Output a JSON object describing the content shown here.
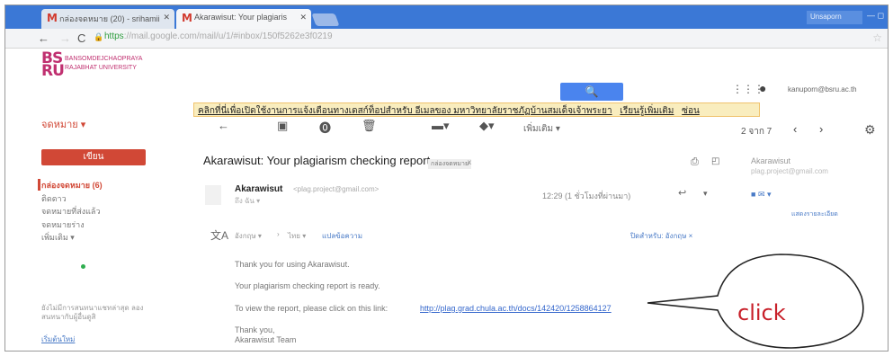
{
  "browser": {
    "tabs": [
      {
        "label": "กล่องจดหมาย (20) - srihamii"
      },
      {
        "label": "Akarawisut: Your plagiaris"
      }
    ],
    "window_label": "Unsaporn",
    "url_scheme": "https",
    "url_rest": "://mail.google.com/mail/u/1/#inbox/150f5262e3f0219"
  },
  "gmail": {
    "logo_mark": "BS\nRU",
    "logo_text": "BANSOMDEJCHAOPRAYA\nRAJABHAT UNIVERSITY",
    "compose_menu": "จดหมาย ▾",
    "compose_button": "เขียน",
    "user_email": "kanuporn@bsru.ac.th",
    "notice_text": "คลิกที่นี่เพื่อเปิดใช้งานการแจ้งเตือนทางเดสก์ท็อปสำหรับ อีเมลของ มหาวิทยาลัยราชภัฏบ้านสมเด็จเจ้าพระยา",
    "notice_learn": "เรียนรู้เพิ่มเติม",
    "notice_hide": "ซ่อน",
    "toolbar_more": "เพิ่มเติม ▾",
    "pager": "2 จาก 7"
  },
  "nav": {
    "items": [
      {
        "label": "กล่องจดหมาย (6)"
      },
      {
        "label": "ติดดาว"
      },
      {
        "label": "จดหมายที่ส่งแล้ว"
      },
      {
        "label": "จดหมายร่าง"
      },
      {
        "label": "เพิ่มเติม ▾"
      }
    ],
    "side_note": "ยังไม่มีการสนทนาแชทล่าสุด ลองสนทนากับผู้อื่นดูสิ",
    "side_link": "เริ่มต้นใหม่"
  },
  "email": {
    "subject": "Akarawisut: Your plagiarism checking report",
    "label": "กล่องจดหมาย",
    "label_close": "x",
    "sender_name": "Akarawisut",
    "sender_email": "<plag.project@gmail.com>",
    "to": "ถึง ฉัน ▾",
    "time": "12:29 (1 ชั่วโมงที่ผ่านมา)",
    "translate_from": "อังกฤษ ▾",
    "translate_arrow": "›",
    "translate_to": "ไทย ▾",
    "translate_link": "แปลข้อความ",
    "translate_off": "ปิดสำหรับ: อังกฤษ ×",
    "body": {
      "line1": "Thank you for using Akarawisut.",
      "line2": "Your plagiarism checking report is ready.",
      "line3": "To view the report, please click on this link:",
      "link": "http://plag.grad.chula.ac.th/docs/142420/1258864127",
      "line4": "Thank you,",
      "line5": "Akarawisut Team"
    }
  },
  "contact": {
    "name": "Akarawisut",
    "email": "plag.project@gmail.com",
    "more": "แสดงรายละเอียด"
  },
  "annotation": {
    "label": "click"
  }
}
